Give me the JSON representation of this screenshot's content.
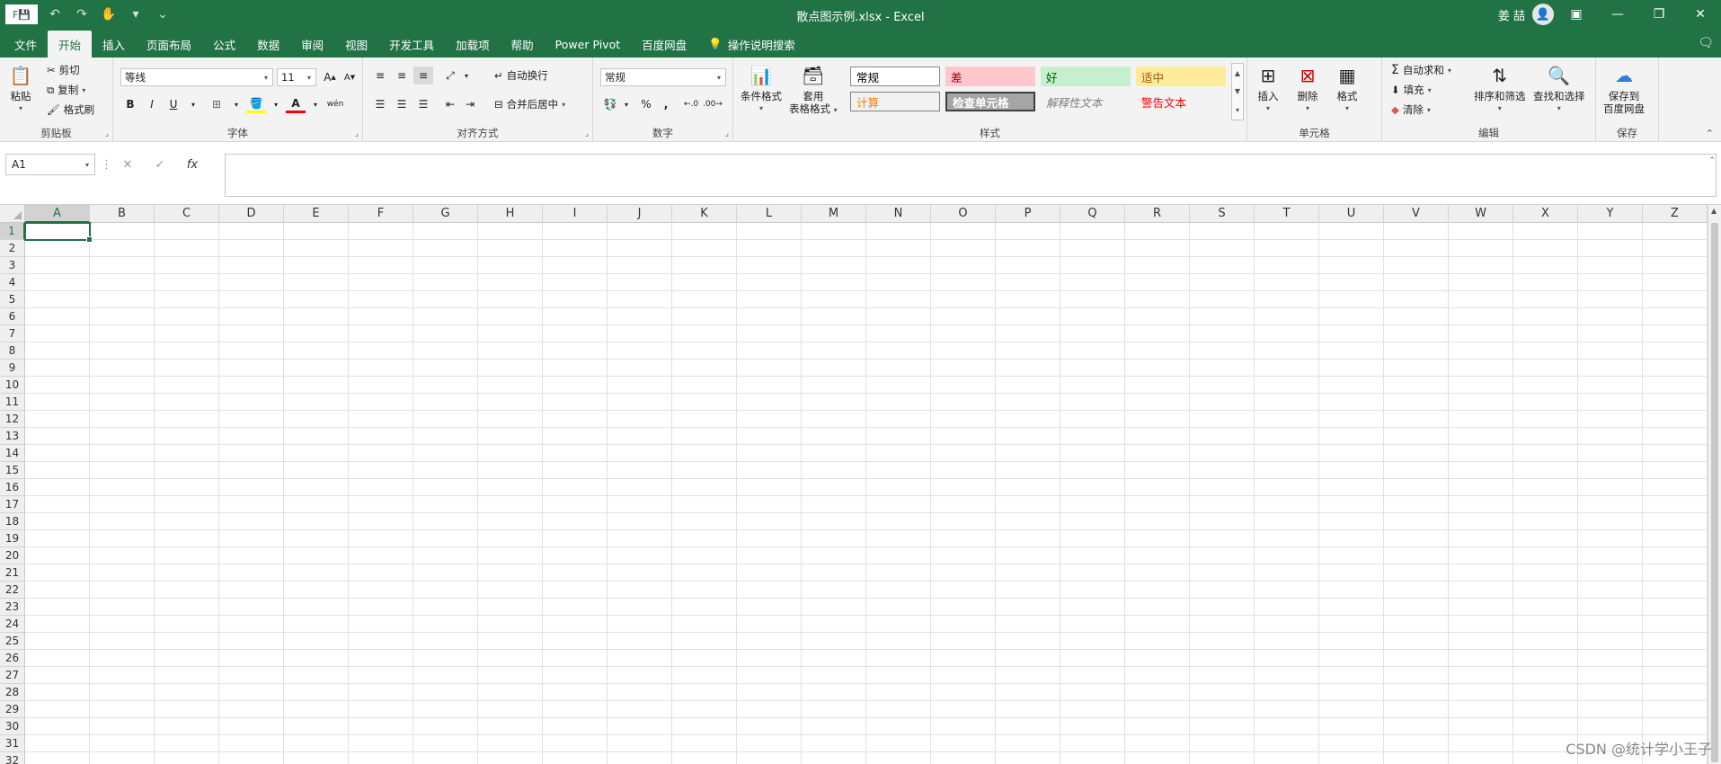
{
  "window": {
    "title": "散点图示例.xlsx  -  Excel",
    "user_name": "姜 喆",
    "file_letter": "F",
    "app_icon": "excel-icon"
  },
  "qat": {
    "undo": "↶",
    "redo": "↷",
    "touch": "✋",
    "more": "▾",
    "customize": "⌄"
  },
  "tabs": [
    "文件",
    "开始",
    "插入",
    "页面布局",
    "公式",
    "数据",
    "审阅",
    "视图",
    "开发工具",
    "加载项",
    "帮助",
    "Power Pivot",
    "百度网盘",
    "操作说明搜索"
  ],
  "active_tab": "开始",
  "ribbon": {
    "clipboard": {
      "label": "剪贴板",
      "paste": "粘贴",
      "cut": "剪切",
      "copy": "复制",
      "format_painter": "格式刷"
    },
    "font": {
      "label": "字体",
      "font_name": "等线",
      "font_size": "11",
      "bold": "B",
      "italic": "I",
      "underline": "U",
      "grow": "A",
      "shrink": "A",
      "phonetic": "wén"
    },
    "alignment": {
      "label": "对齐方式",
      "wrap_text": "自动换行",
      "merge_center": "合并后居中"
    },
    "number": {
      "label": "数字",
      "format": "常规",
      "percent": "%",
      "comma": ","
    },
    "styles": {
      "label": "样式",
      "conditional": "条件格式",
      "table_format_line1": "套用",
      "table_format_line2": "表格格式",
      "cells": [
        {
          "text": "常规",
          "bg": "#ffffff",
          "color": "#000000"
        },
        {
          "text": "差",
          "bg": "#ffc7ce",
          "color": "#9c0006"
        },
        {
          "text": "好",
          "bg": "#c6efce",
          "color": "#006100"
        },
        {
          "text": "适中",
          "bg": "#ffeb9c",
          "color": "#9c5700"
        },
        {
          "text": "计算",
          "bg": "#f2f2f2",
          "color": "#fa7d00"
        },
        {
          "text": "检查单元格",
          "bg": "#a5a5a5",
          "color": "#ffffff"
        },
        {
          "text": "解释性文本",
          "bg": "#f3f3f3",
          "color": "#7f7f7f"
        },
        {
          "text": "警告文本",
          "bg": "#f3f3f3",
          "color": "#ff0000"
        }
      ]
    },
    "cells": {
      "label": "单元格",
      "insert": "插入",
      "delete": "删除",
      "format": "格式"
    },
    "editing": {
      "label": "编辑",
      "autosum": "自动求和",
      "fill": "填充",
      "clear": "清除",
      "sort_filter": "排序和筛选",
      "find_select": "查找和选择"
    },
    "save": {
      "label": "保存",
      "save_to_line1": "保存到",
      "save_to_line2": "百度网盘"
    }
  },
  "formula_bar": {
    "name_box": "A1",
    "cancel": "✕",
    "enter": "✓",
    "fx": "fx",
    "formula": ""
  },
  "sheet": {
    "columns": [
      "A",
      "B",
      "C",
      "D",
      "E",
      "F",
      "G",
      "H",
      "I",
      "J",
      "K",
      "L",
      "M",
      "N",
      "O",
      "P",
      "Q",
      "R",
      "S",
      "T",
      "U",
      "V",
      "W",
      "X",
      "Y",
      "Z"
    ],
    "rows": [
      "1",
      "2",
      "3",
      "4",
      "5",
      "6",
      "7",
      "8",
      "9",
      "10",
      "11",
      "12",
      "13",
      "14",
      "15",
      "16",
      "17",
      "18",
      "19",
      "20",
      "21",
      "22",
      "23",
      "24",
      "25",
      "26",
      "27",
      "28",
      "29",
      "30",
      "31",
      "32"
    ],
    "selected_column": "A",
    "selected_row": "1"
  },
  "watermark": "CSDN @统计学小王子",
  "colors": {
    "accent": "#217346"
  }
}
